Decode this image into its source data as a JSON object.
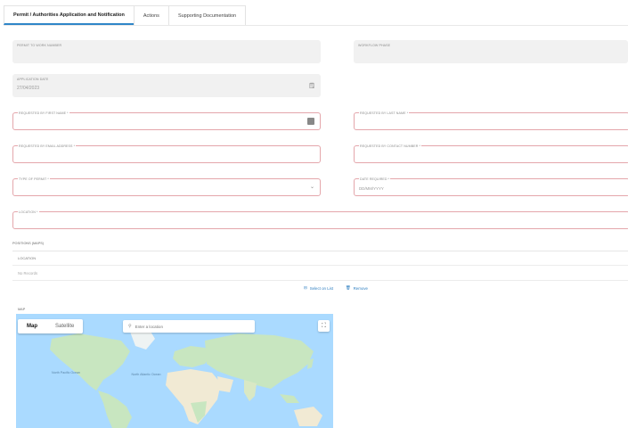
{
  "tabs": [
    {
      "label": "Permit / Authorities Application and Notification"
    },
    {
      "label": "Actions"
    },
    {
      "label": "Supporting Documentation"
    }
  ],
  "fields": {
    "permit_to_work_number": {
      "label": "PERMIT TO WORK NUMBER",
      "value": ""
    },
    "workflow_phase": {
      "label": "WORKFLOW PHASE",
      "value": ""
    },
    "application_date": {
      "label": "APPLICATION DATE",
      "value": "27/04/2023"
    },
    "requested_by_first_name": {
      "label": "REQUESTED BY FIRST NAME *",
      "value": ""
    },
    "requested_by_last_name": {
      "label": "REQUESTED BY LAST NAME *",
      "value": ""
    },
    "requested_by_email": {
      "label": "REQUESTED BY EMAIL ADDRESS *",
      "value": ""
    },
    "requested_by_contact": {
      "label": "REQUESTED BY CONTACT NUMBER *",
      "value": ""
    },
    "type_of_permit": {
      "label": "TYPE OF PERMIT *",
      "value": ""
    },
    "date_required": {
      "label": "DATE REQUIRED *",
      "placeholder": "DD/MM/YYYY"
    },
    "location": {
      "label": "LOCATION *",
      "value": ""
    }
  },
  "positions": {
    "label": "POSITIONS (MAPS)",
    "column": "LOCATION",
    "empty_text": "No Records",
    "select_on_list": "Select on List",
    "remove": "Remove"
  },
  "map": {
    "label": "MAP",
    "mode_map": "Map",
    "mode_satellite": "Satellite",
    "search_placeholder": "Enter a location",
    "oceans": {
      "north_pacific": "North Pacific Ocean",
      "north_atlantic": "North Atlantic Ocean"
    },
    "colors": {
      "water": "#aadaff",
      "land": "#c8e6c0",
      "desert": "#f1ead4"
    }
  },
  "icons": [
    "calendar-icon",
    "contact-card-icon",
    "chevron-down-icon",
    "select-list-icon",
    "trash-icon",
    "search-icon",
    "fullscreen-icon"
  ]
}
